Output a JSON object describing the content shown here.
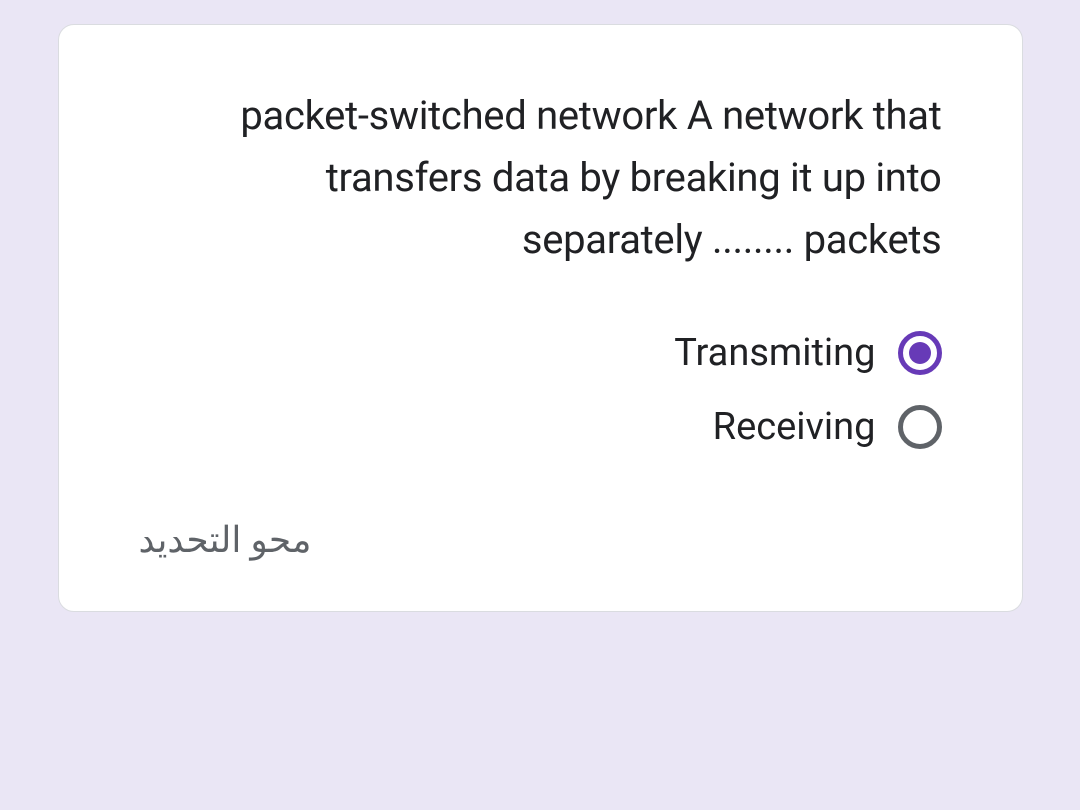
{
  "question": {
    "text": "packet-switched network A network that transfers data by breaking it up into separately ........ packets"
  },
  "options": [
    {
      "label": "Transmiting",
      "selected": true
    },
    {
      "label": "Receiving",
      "selected": false
    }
  ],
  "clear_selection": "محو التحديد"
}
